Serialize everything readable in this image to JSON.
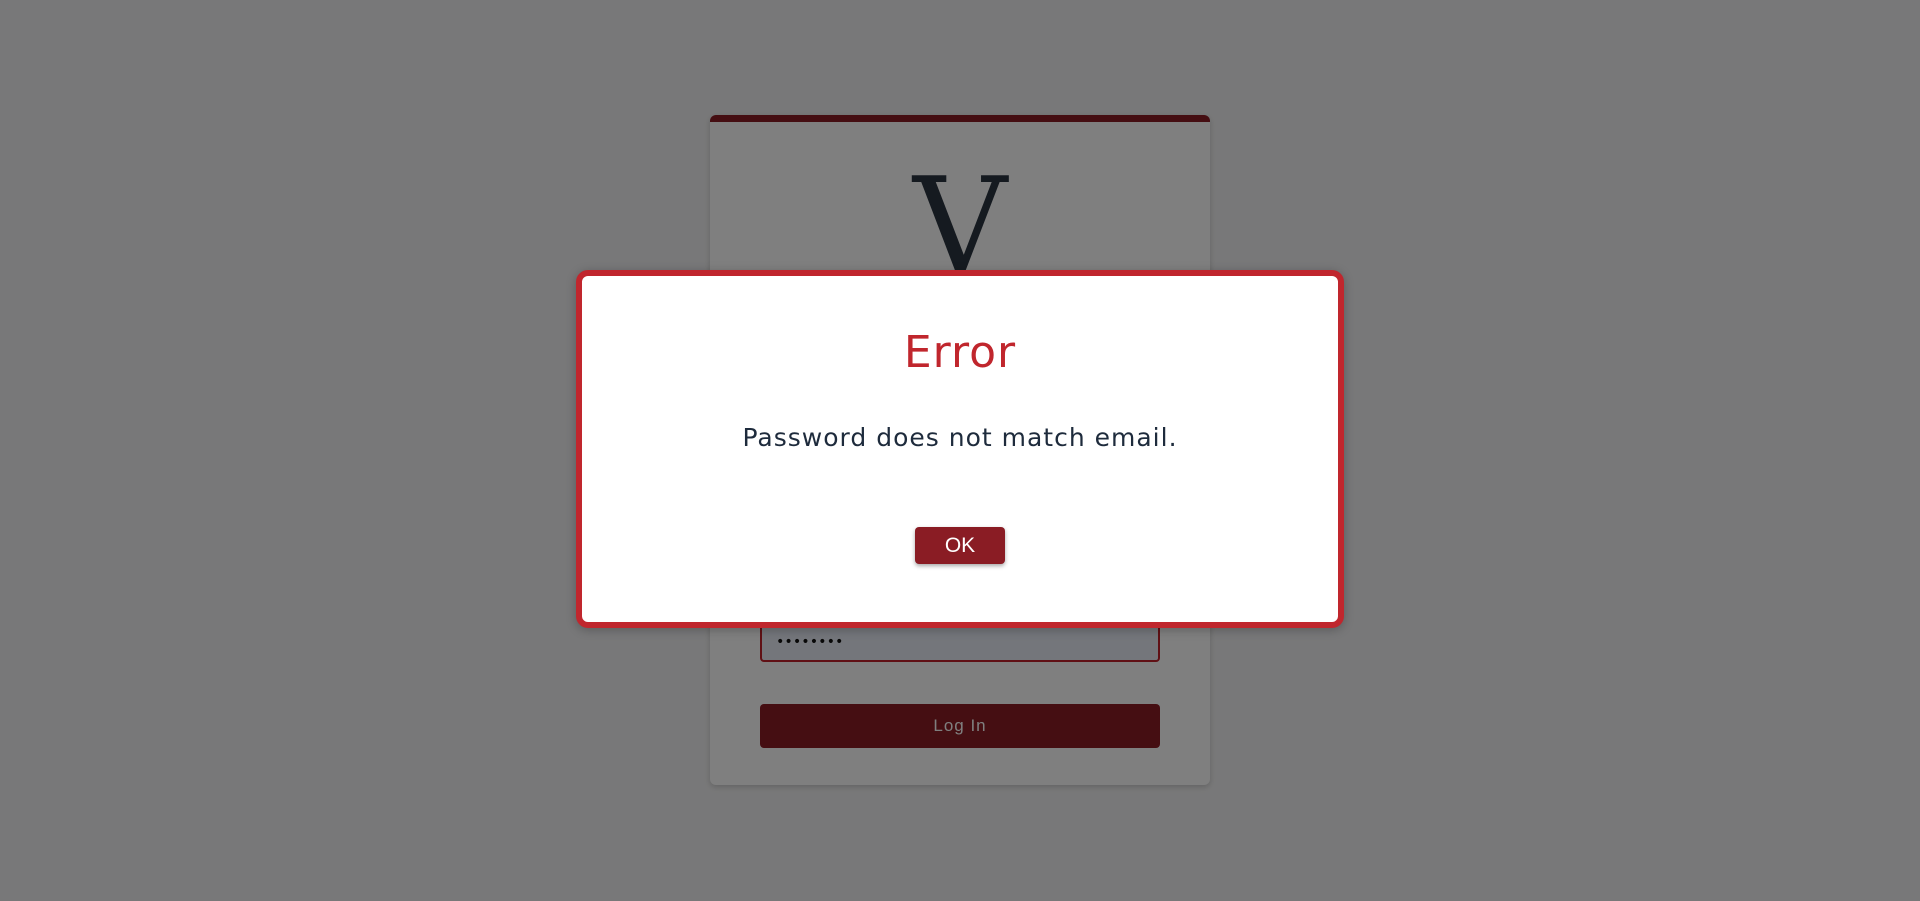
{
  "login": {
    "logo_letter": "V",
    "password_value": "••••••••",
    "login_label": "Log In"
  },
  "error_modal": {
    "title": "Error",
    "message": "Password does not match email.",
    "ok_label": "OK"
  },
  "colors": {
    "accent": "#8a1c24",
    "error": "#c0262d",
    "message_text": "#1e2b3c"
  }
}
